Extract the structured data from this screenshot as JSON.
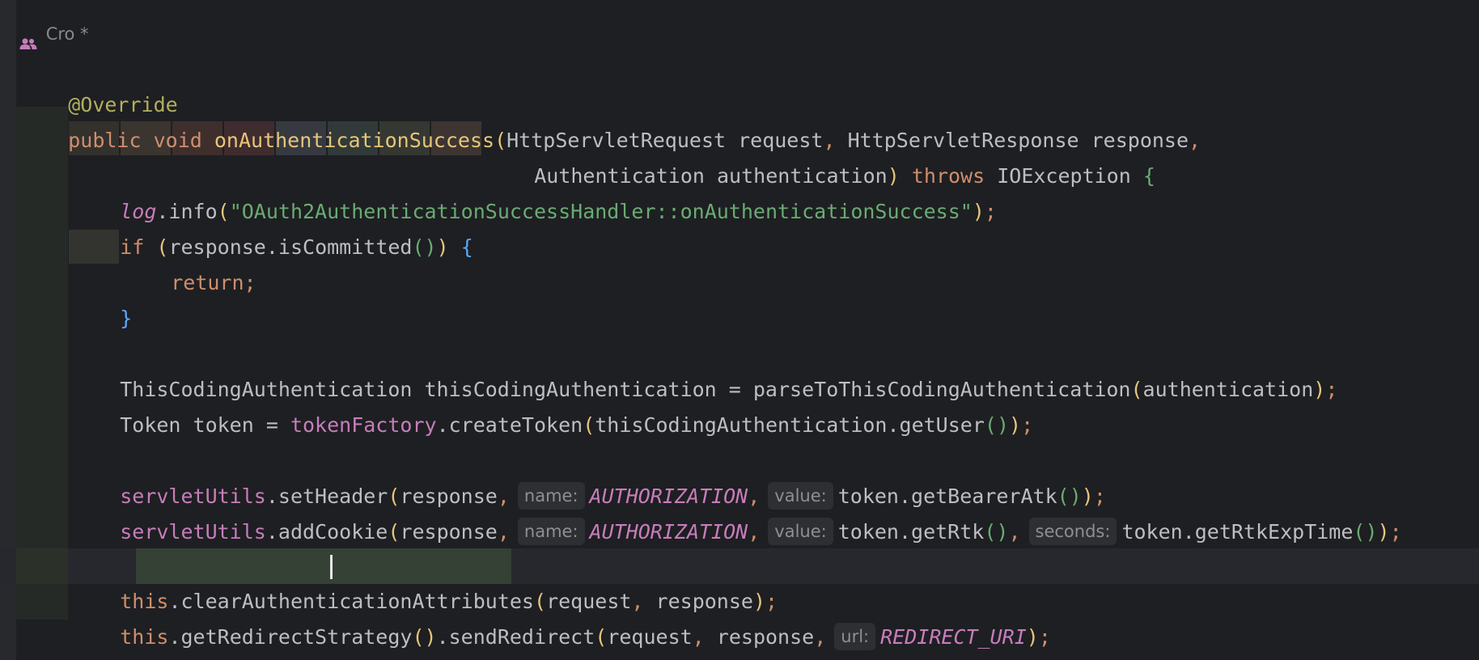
{
  "editor": {
    "author_label": "Cro *",
    "lines": {
      "l1": {
        "annotation": "@Override"
      },
      "l2": {
        "kw1": "public",
        "kw2": "void",
        "method": "onAuthenticationSuccess",
        "open": "(",
        "t1": "HttpServletRequest request",
        "comma1": ",",
        "t2": " HttpServletResponse response",
        "comma2": ","
      },
      "l3": {
        "params": "Authentication authentication",
        "close": ")",
        "throws": "throws",
        "exc": "IOException",
        "brace": "{"
      },
      "l4": {
        "field": "log",
        "call": ".info",
        "open": "(",
        "str": "\"OAuth2AuthenticationSuccessHandler::onAuthenticationSuccess\"",
        "close": ")",
        "semi": ";"
      },
      "l5": {
        "kw": "if",
        "open": "(",
        "expr": "response.isCommitted",
        "inner": "()",
        "close": ")",
        "brace": "{"
      },
      "l6": {
        "kw": "return",
        "semi": ";"
      },
      "l7": {
        "brace": "}"
      },
      "l8": {
        "decl": "ThisCodingAuthentication thisCodingAuthentication = parseToThisCodingAuthentication",
        "open": "(",
        "arg": "authentication",
        "close": ")",
        "semi": ";"
      },
      "l9": {
        "decl": "Token token = ",
        "field": "tokenFactory",
        "call": ".createToken",
        "open": "(",
        "arg": "thisCodingAuthentication.getUser",
        "inner": "()",
        "close": ")",
        "semi": ";"
      },
      "l10": {
        "field": "servletUtils",
        "call": ".setHeader",
        "open": "(",
        "arg1": "response",
        "comma1": ",",
        "hint1": "name:",
        "const1": "AUTHORIZATION",
        "comma2": ",",
        "hint2": "value:",
        "arg3": "token.getBearerAtk",
        "inner": "()",
        "close": ")",
        "semi": ";"
      },
      "l11": {
        "field": "servletUtils",
        "call": ".addCookie",
        "open": "(",
        "arg1": "response",
        "comma1": ",",
        "hint1": "name:",
        "const1": "AUTHORIZATION",
        "comma2": ",",
        "hint2": "value:",
        "arg3": "token.getRtk",
        "inner1": "()",
        "comma3": ",",
        "hint3": "seconds:",
        "arg4": "token.getRtkExpTime",
        "inner2": "()",
        "close": ")",
        "semi": ";"
      },
      "l12": {
        "kw": "this",
        "dot": ".",
        "method": "clearAuthenticationAttributes",
        "open": "(",
        "arg1": "request",
        "comma": ",",
        "arg2": " response",
        "close": ")",
        "semi": ";"
      },
      "l13": {
        "kw": "this",
        "call": ".getRedirectStrategy",
        "inner": "()",
        "call2": ".sendRedirect",
        "open": "(",
        "arg1": "request",
        "comma1": ",",
        "arg2": " response",
        "comma2": ",",
        "hint": "url:",
        "const": "REDIRECT_URI",
        "close": ")",
        "semi": ";"
      },
      "l14": {
        "brace": "}"
      }
    }
  },
  "colors": {
    "background": "#1e1f22",
    "keyword": "#cf8e6d",
    "method_decl": "#e8c57a",
    "string": "#6aab73",
    "field": "#c77dbb",
    "annotation": "#b3ae60",
    "text": "#bcbec4",
    "usage_highlight": "#344134"
  },
  "icons": {
    "author_icon": "people-icon"
  }
}
